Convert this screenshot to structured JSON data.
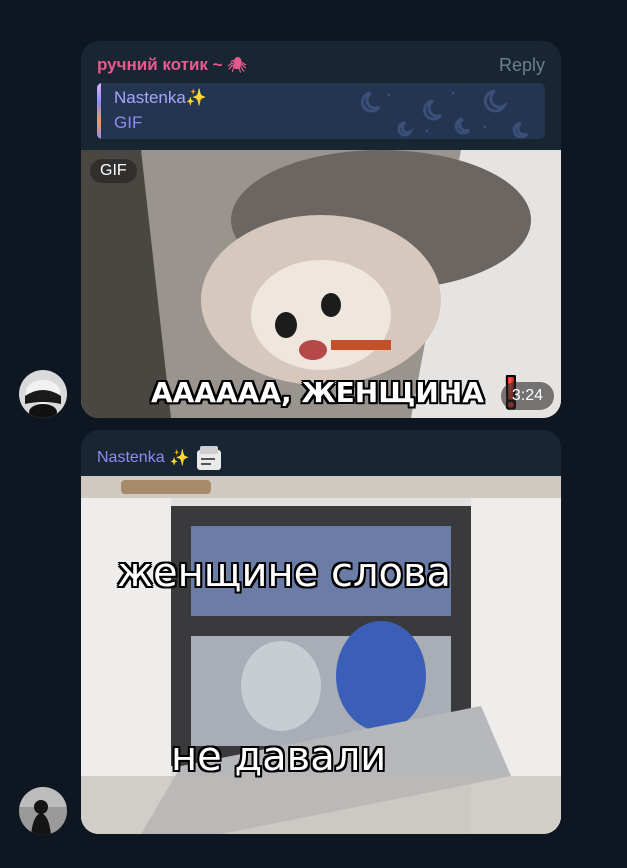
{
  "messages": [
    {
      "sender": "ручний котик ~",
      "sender_emoji": "🕷",
      "reply_label": "Reply",
      "quote": {
        "name": "Nastenka",
        "name_emoji": "✨",
        "text": "GIF"
      },
      "media": {
        "type_badge": "GIF",
        "duration": "3:24",
        "caption": "АААААА, ЖЕНЩИНА ❗"
      }
    },
    {
      "sender": "Nastenka",
      "sender_emoji": "✨",
      "media": {
        "caption_top": "женщине  слова",
        "caption_bottom": "не  давали"
      }
    }
  ],
  "colors": {
    "background": "#0e1621",
    "bubble": "#182533",
    "sender1": "#e85a8c",
    "sender2": "#8e8cf2",
    "quote_bg": "#233550"
  }
}
